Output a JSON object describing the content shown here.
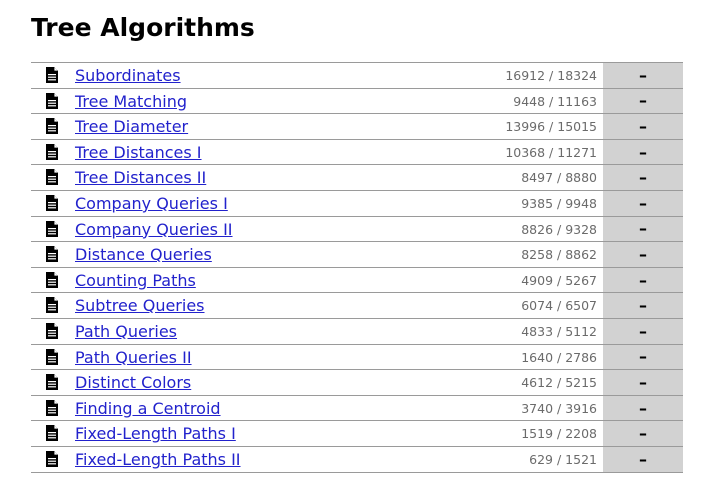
{
  "section_title": "Tree Algorithms",
  "tasks": [
    {
      "name": "Subordinates",
      "count": "16912 / 18324",
      "status": "–"
    },
    {
      "name": "Tree Matching",
      "count": "9448 / 11163",
      "status": "–"
    },
    {
      "name": "Tree Diameter",
      "count": "13996 / 15015",
      "status": "–"
    },
    {
      "name": "Tree Distances I",
      "count": "10368 / 11271",
      "status": "–"
    },
    {
      "name": "Tree Distances II",
      "count": "8497 / 8880",
      "status": "–"
    },
    {
      "name": "Company Queries I",
      "count": "9385 / 9948",
      "status": "–"
    },
    {
      "name": "Company Queries II",
      "count": "8826 / 9328",
      "status": "–"
    },
    {
      "name": "Distance Queries",
      "count": "8258 / 8862",
      "status": "–"
    },
    {
      "name": "Counting Paths",
      "count": "4909 / 5267",
      "status": "–"
    },
    {
      "name": "Subtree Queries",
      "count": "6074 / 6507",
      "status": "–"
    },
    {
      "name": "Path Queries",
      "count": "4833 / 5112",
      "status": "–"
    },
    {
      "name": "Path Queries II",
      "count": "1640 / 2786",
      "status": "–"
    },
    {
      "name": "Distinct Colors",
      "count": "4612 / 5215",
      "status": "–"
    },
    {
      "name": "Finding a Centroid",
      "count": "3740 / 3916",
      "status": "–"
    },
    {
      "name": "Fixed-Length Paths I",
      "count": "1519 / 2208",
      "status": "–"
    },
    {
      "name": "Fixed-Length Paths II",
      "count": "629 / 1521",
      "status": "–"
    }
  ],
  "icons": {
    "task_icon": "document-icon"
  },
  "colors": {
    "link": "#2222cc",
    "status_background": "#d2d2d2",
    "count_text": "#6b6b6b",
    "row_border": "#9a9a9a"
  }
}
